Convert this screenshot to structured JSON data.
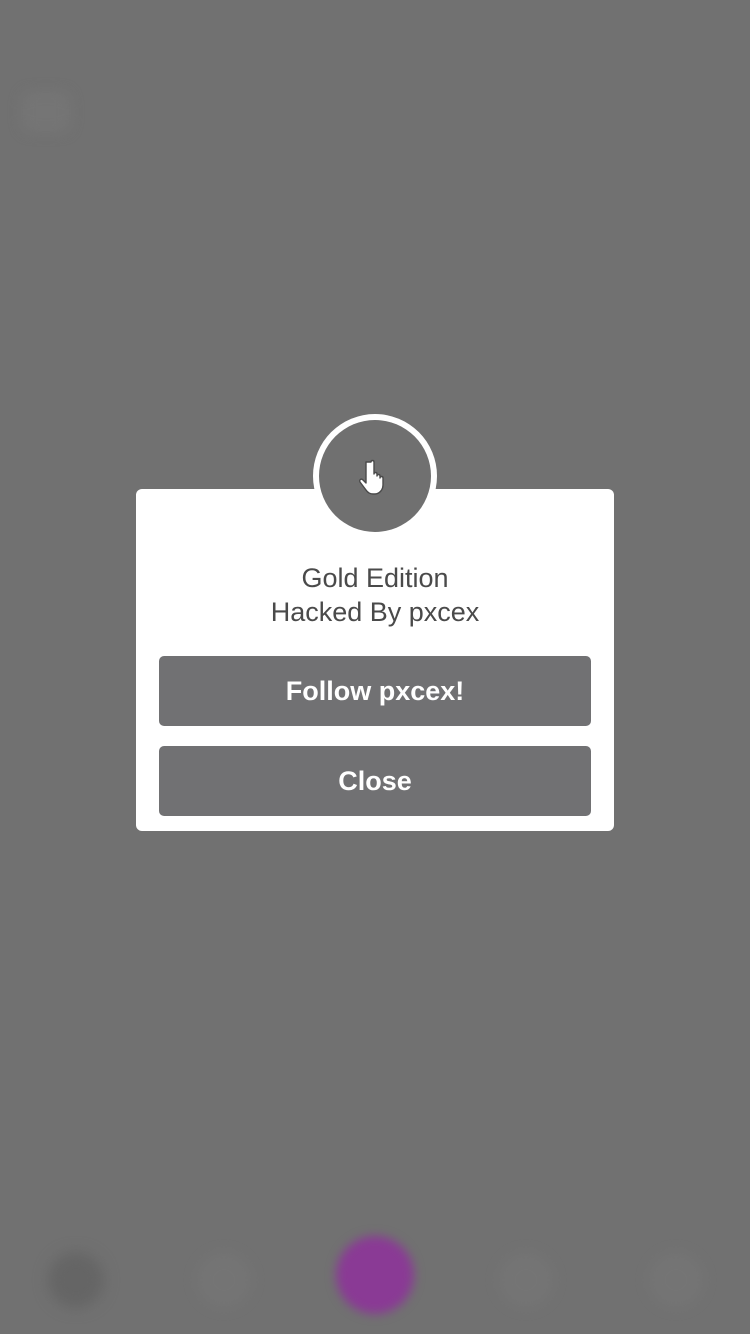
{
  "dialog": {
    "icon": "hand-pointer-icon",
    "title_line1": "Gold Edition",
    "title_line2": "Hacked By pxcex",
    "follow_label": "Follow pxcex!",
    "close_label": "Close"
  },
  "colors": {
    "overlay": "#717171",
    "dialog_bg": "#ffffff",
    "button_bg": "#717173",
    "button_text": "#ffffff",
    "title_text": "#4a4a4a",
    "center_tab_accent": "#8a3a95"
  },
  "tabbar": {
    "tabs": [
      {
        "icon": "home-icon"
      },
      {
        "icon": "search-icon"
      },
      {
        "icon": "camera-icon"
      },
      {
        "icon": "heart-icon"
      },
      {
        "icon": "profile-icon"
      }
    ]
  }
}
